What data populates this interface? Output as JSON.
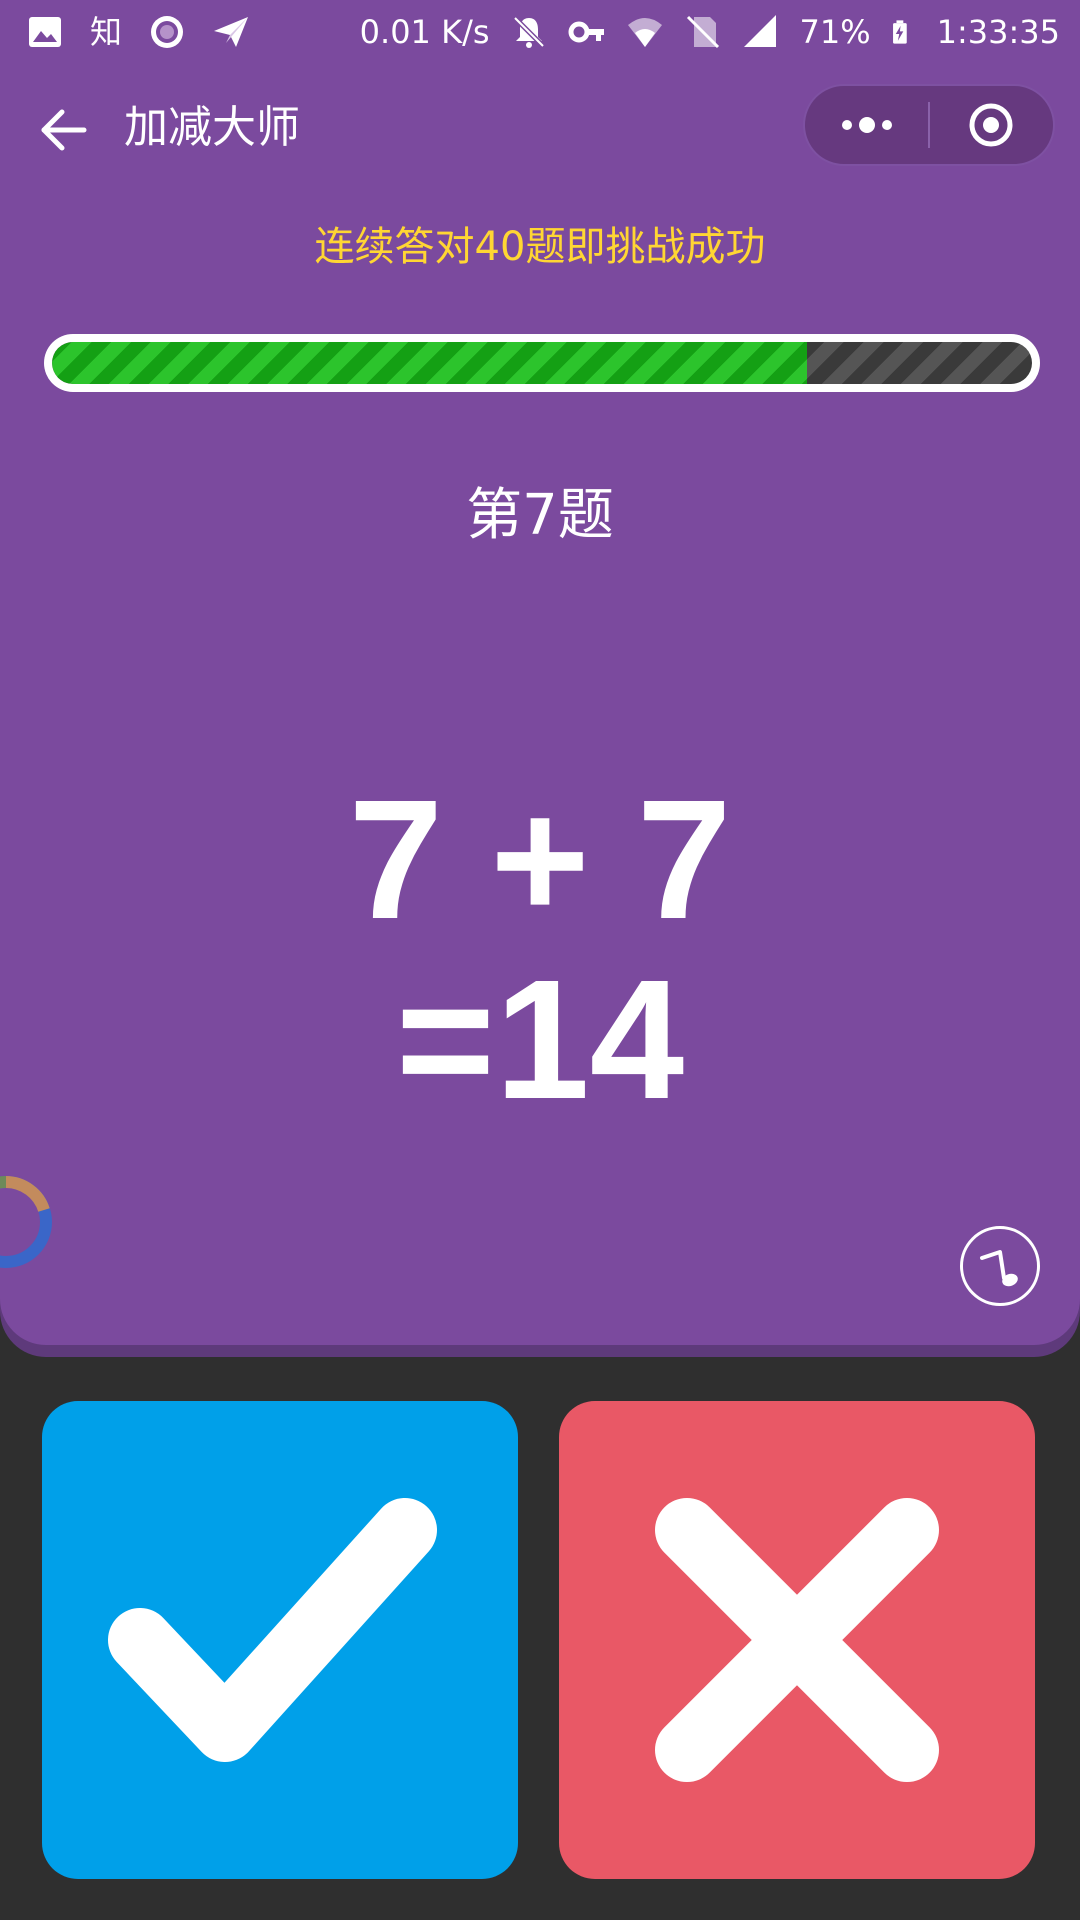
{
  "status_bar": {
    "left_icons": [
      "image-icon",
      "zhihu-icon",
      "record-icon",
      "send-icon"
    ],
    "zhihu_label": "知",
    "net_speed": "0.01 K/s",
    "right_icons": [
      "mute-bell-icon",
      "vpn-key-icon",
      "wifi-icon",
      "no-sim-icon",
      "signal-icon",
      "battery-charging-icon"
    ],
    "battery": "71%",
    "time": "1:33:35"
  },
  "title_bar": {
    "title": "加减大师",
    "back_icon": "arrow-left-icon",
    "more_icon": "more-dots-icon",
    "close_icon": "target-circle-icon"
  },
  "game": {
    "hint": "连续答对40题即挑战成功",
    "progress": {
      "fraction": 0.77
    },
    "question_label": "第7题",
    "equation_line1": "7 + 7",
    "equation_line2": "=14",
    "music_icon": "music-note-icon",
    "spinner_icon": "loading-spinner-icon"
  },
  "answers": {
    "correct_icon": "checkmark-icon",
    "wrong_icon": "cross-icon"
  },
  "colors": {
    "panel_purple": "#7b4a9e",
    "panel_shadow": "#5e3a7b",
    "hint_yellow": "#ffd633",
    "progress_green": "#2cc42c",
    "correct_blue": "#00a0e9",
    "wrong_red": "#e95866",
    "background_dark": "#2f2f2f"
  }
}
